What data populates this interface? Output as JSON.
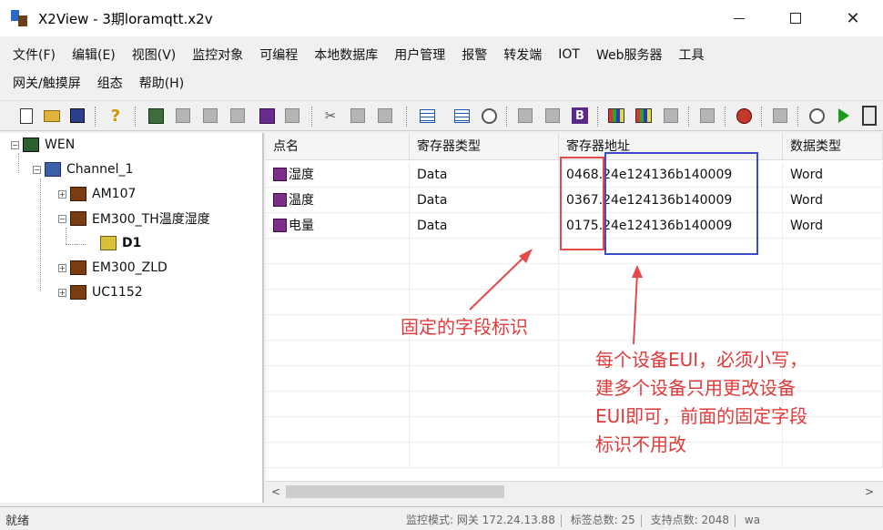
{
  "window": {
    "title": "X2View - 3期loramqtt.x2v",
    "minimize": "—",
    "maximize": "☐",
    "close": "✕"
  },
  "menu": {
    "row1": [
      "文件(F)",
      "编辑(E)",
      "视图(V)",
      "监控对象",
      "可编程",
      "本地数据库",
      "用户管理",
      "报警",
      "转发端",
      "IOT",
      "Web服务器",
      "工具"
    ],
    "row2": [
      "网关/触摸屏",
      "组态",
      "帮助(H)"
    ]
  },
  "toolbar": {
    "icons": [
      "new-doc-icon",
      "open-folder-icon",
      "save-icon",
      "help-icon",
      "grid-icon",
      "gray-tool-icon",
      "gray-tool-icon",
      "gray-tool-icon",
      "purple-tool-icon",
      "properties-icon",
      "cut-icon",
      "copy-icon",
      "paste-icon",
      "list-icon",
      "list-icon",
      "clock-icon",
      "tools-icon",
      "tools-icon",
      "b-icon",
      "chart-icon",
      "chart-icon",
      "window-icon",
      "gateway-icon",
      "alarm-icon",
      "device-icon",
      "eye-icon",
      "run-icon",
      "stop-icon"
    ]
  },
  "tree": {
    "root": "WEN",
    "channel": "Channel_1",
    "devices": [
      "AM107",
      "EM300_TH温度湿度",
      "EM300_ZLD",
      "UC1152"
    ],
    "selected_child": "D1",
    "expand_plus": "+",
    "expand_minus": "−"
  },
  "grid": {
    "columns": [
      "点名",
      "寄存器类型",
      "寄存器地址",
      "数据类型"
    ],
    "rows": [
      {
        "name": "湿度",
        "type": "Data",
        "address": "0468.24e124136b140009",
        "dtype": "Word"
      },
      {
        "name": "温度",
        "type": "Data",
        "address": "0367.24e124136b140009",
        "dtype": "Word"
      },
      {
        "name": "电量",
        "type": "Data",
        "address": "0175.24e124136b140009",
        "dtype": "Word"
      }
    ],
    "scroll_left": "<",
    "scroll_right": ">"
  },
  "status": {
    "left": "就绪",
    "mode": "监控模式: 网关 172.24.13.88",
    "tags": "标签总数: 25",
    "points": "支持点数: 2048",
    "extra": "wa"
  },
  "annotations": {
    "fixed_label": "固定的字段标识",
    "note_lines": [
      "每个设备EUI，必须小写，",
      "建多个设备只用更改设备",
      "EUI即可，前面的固定字段",
      "标识不用改"
    ],
    "colors": {
      "red": "#e34a4a",
      "blue": "#3a4cc8"
    }
  }
}
